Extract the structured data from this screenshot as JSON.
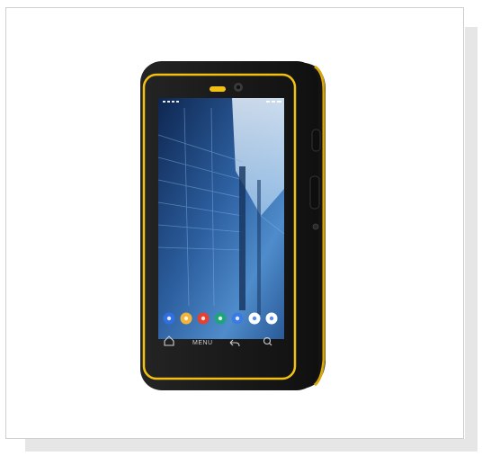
{
  "device": {
    "body_color": "#1b1b1b",
    "trim_color": "#f2c014",
    "menu_label": "MENU"
  },
  "dock_icons": [
    {
      "name": "contacts-icon",
      "color": "#2f6fe0"
    },
    {
      "name": "folder-icon",
      "color": "#f3b43a"
    },
    {
      "name": "chrome-icon",
      "color": "#e34133"
    },
    {
      "name": "settings-icon",
      "color": "#1fa37a"
    },
    {
      "name": "calendar-icon",
      "color": "#3a7be3"
    },
    {
      "name": "play-store-icon",
      "color": "#ffffff"
    },
    {
      "name": "camera-icon",
      "color": "#ffffff"
    }
  ],
  "hardware_keys": [
    "home-key",
    "menu-key",
    "back-key",
    "search-key"
  ]
}
